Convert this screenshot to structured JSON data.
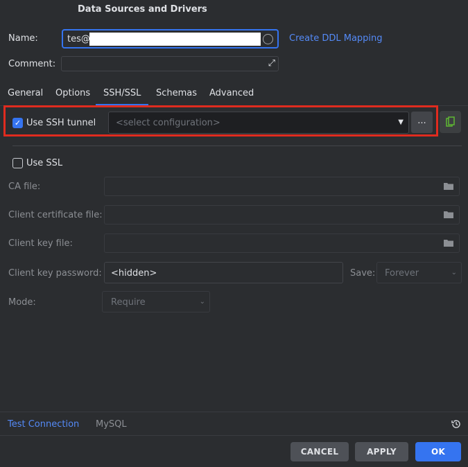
{
  "window": {
    "title": "Data Sources and Drivers"
  },
  "general": {
    "name_label": "Name:",
    "name_value": "tes@",
    "create_ddl_link": "Create DDL Mapping",
    "comment_label": "Comment:"
  },
  "tabs": [
    {
      "label": "General"
    },
    {
      "label": "Options"
    },
    {
      "label": "SSH/SSL",
      "active": true
    },
    {
      "label": "Schemas"
    },
    {
      "label": "Advanced"
    }
  ],
  "ssh": {
    "use_ssh_label": "Use SSH tunnel",
    "use_ssh_checked": true,
    "config_placeholder": "<select configuration>",
    "more_button": "..."
  },
  "ssl": {
    "use_ssl_label": "Use SSL",
    "use_ssl_checked": false,
    "ca_file_label": "CA file:",
    "client_cert_label": "Client certificate file:",
    "client_key_label": "Client key file:",
    "client_key_password_label": "Client key password:",
    "client_key_password_value": "<hidden>",
    "save_label": "Save:",
    "save_value": "Forever",
    "mode_label": "Mode:",
    "mode_value": "Require"
  },
  "footer": {
    "test_connection": "Test Connection",
    "driver": "MySQL"
  },
  "buttons": {
    "cancel": "CANCEL",
    "apply": "APPLY",
    "ok": "OK"
  },
  "colors": {
    "background": "#2b2d30",
    "accent": "#3574f0",
    "link": "#548af7",
    "highlight_box": "#e02b1f"
  }
}
